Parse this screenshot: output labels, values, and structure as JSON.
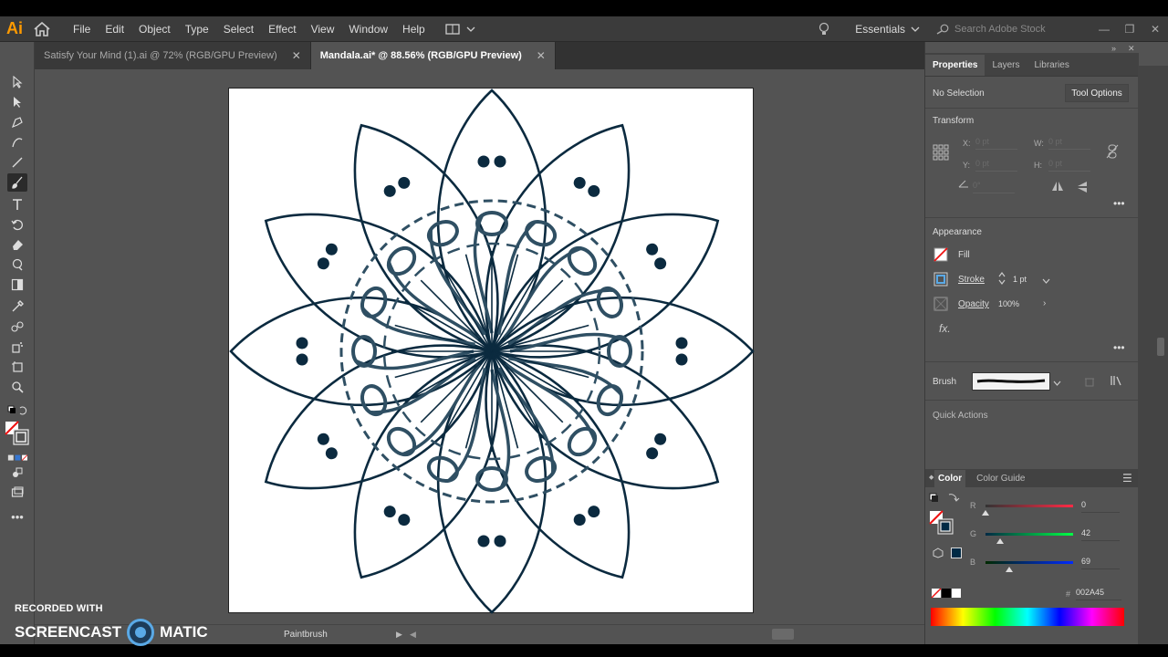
{
  "app": {
    "logo": "Ai"
  },
  "menu": [
    "File",
    "Edit",
    "Object",
    "Type",
    "Select",
    "Effect",
    "View",
    "Window",
    "Help"
  ],
  "workspace": {
    "label": "Essentials"
  },
  "search": {
    "placeholder": "Search Adobe Stock"
  },
  "tabs": [
    {
      "label": "Satisfy Your Mind (1).ai @ 72% (RGB/GPU Preview)",
      "active": false
    },
    {
      "label": "Mandala.ai* @ 88.56% (RGB/GPU Preview)",
      "active": true
    }
  ],
  "status": {
    "tool": "Paintbrush"
  },
  "panel": {
    "tabs": [
      "Properties",
      "Layers",
      "Libraries"
    ],
    "selection": "No Selection",
    "tool_options": "Tool Options",
    "transform": {
      "title": "Transform",
      "x_label": "X:",
      "y_label": "Y:",
      "w_label": "W:",
      "h_label": "H:",
      "x": "0 pt",
      "y": "0 pt",
      "w": "0 pt",
      "h": "0 pt",
      "angle": "0°"
    },
    "appearance": {
      "title": "Appearance",
      "fill": "Fill",
      "stroke": "Stroke",
      "stroke_weight": "1 pt",
      "opacity": "Opacity",
      "opacity_value": "100%",
      "fx": "fx."
    },
    "brush": {
      "label": "Brush"
    },
    "quick_actions": "Quick Actions",
    "color": {
      "tabs": [
        "Color",
        "Color Guide"
      ],
      "r_label": "R",
      "g_label": "G",
      "b_label": "B",
      "r": "0",
      "g": "42",
      "b": "69",
      "hex_label": "#",
      "hex": "002A45",
      "stroke_color": "#002a45"
    }
  },
  "watermark": {
    "line1": "RECORDED WITH",
    "line2a": "SCREENCAST",
    "line2b": "MATIC"
  },
  "colors": {
    "accent": "#ff9a00",
    "ink": "#0b2a3f"
  }
}
